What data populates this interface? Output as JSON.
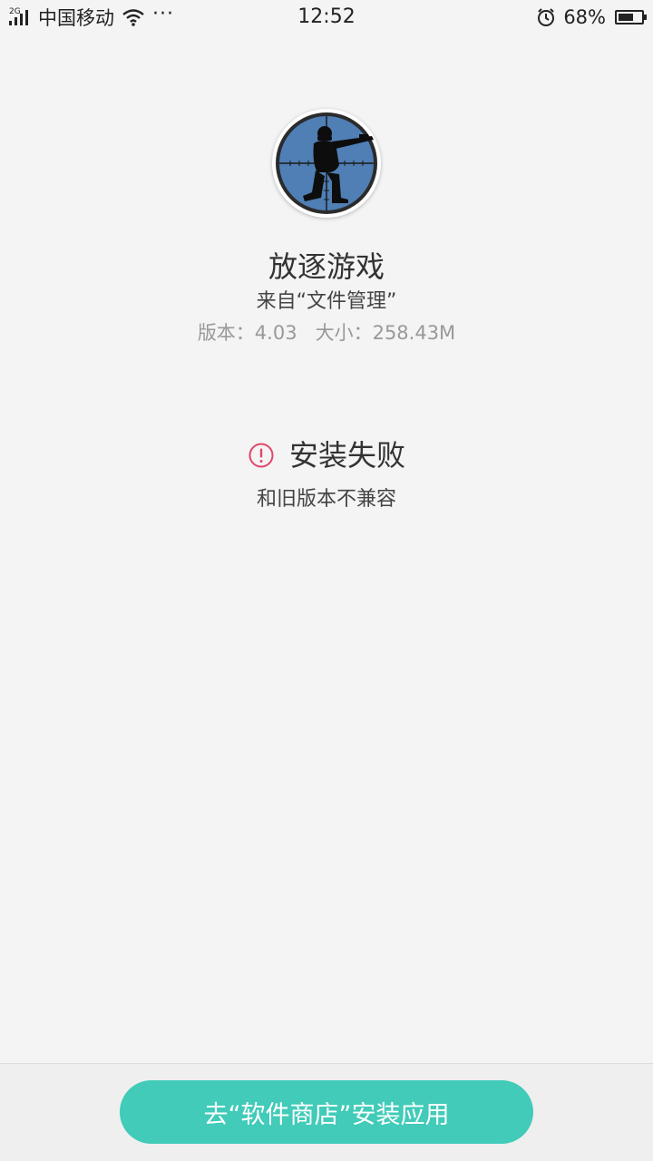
{
  "status_bar": {
    "network_type": "2G",
    "carrier": "中国移动",
    "more": "···",
    "time": "12:52",
    "battery_percent": "68%",
    "battery_level": 0.68,
    "icons": [
      "signal-icon",
      "wifi-icon",
      "alarm-icon",
      "battery-icon"
    ]
  },
  "app": {
    "icon": "sniper-game-icon",
    "name": "放逐游戏",
    "source": "来自“文件管理”",
    "version_label": "版本：4.03",
    "size_label": "大小：258.43M"
  },
  "result": {
    "icon": "error-icon",
    "title": "安装失败",
    "reason": "和旧版本不兼容"
  },
  "actions": {
    "store_button_label": "去“软件商店”安装应用"
  },
  "colors": {
    "background": "#f4f4f4",
    "accent": "#41cbb8",
    "error": "#e0476a",
    "icon_blue": "#4f7fb5",
    "secondary_text": "#999999"
  }
}
